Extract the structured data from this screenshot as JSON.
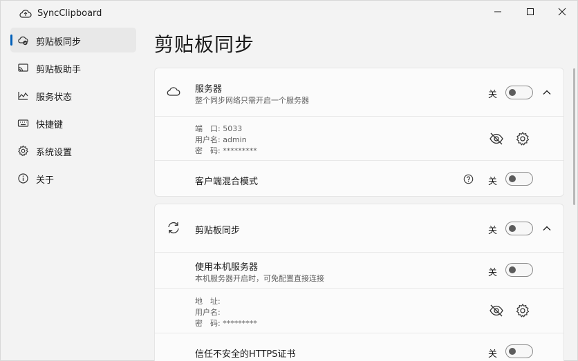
{
  "window": {
    "title": "SyncClipboard"
  },
  "sidebar": {
    "items": [
      {
        "label": "剪贴板同步",
        "icon": "cloud-sync-icon",
        "active": true
      },
      {
        "label": "剪贴板助手",
        "icon": "cast-icon",
        "active": false
      },
      {
        "label": "服务状态",
        "icon": "chart-icon",
        "active": false
      },
      {
        "label": "快捷键",
        "icon": "keyboard-icon",
        "active": false
      },
      {
        "label": "系统设置",
        "icon": "gear-icon",
        "active": false
      },
      {
        "label": "关于",
        "icon": "info-icon",
        "active": false
      }
    ]
  },
  "page": {
    "title": "剪贴板同步"
  },
  "server_card": {
    "title": "服务器",
    "subtitle": "整个同步网络只需开启一个服务器",
    "toggle_label": "关",
    "port_label": "端　口: 5033",
    "user_label": "用户名: admin",
    "password_label": "密　码: *********",
    "mixed_mode_title": "客户端混合模式",
    "mixed_mode_toggle": "关"
  },
  "sync_card": {
    "title": "剪贴板同步",
    "toggle_label": "关",
    "local_server_title": "使用本机服务器",
    "local_server_sub": "本机服务器开启时，可免配置直接连接",
    "local_server_toggle": "关",
    "address_label": "地　址:",
    "user_label": "用户名:",
    "password_label": "密　码: *********",
    "https_title": "信任不安全的HTTPS证书",
    "https_toggle": "关"
  },
  "colors": {
    "accent": "#005fb8",
    "toggle_off": "#5c5c5c"
  }
}
